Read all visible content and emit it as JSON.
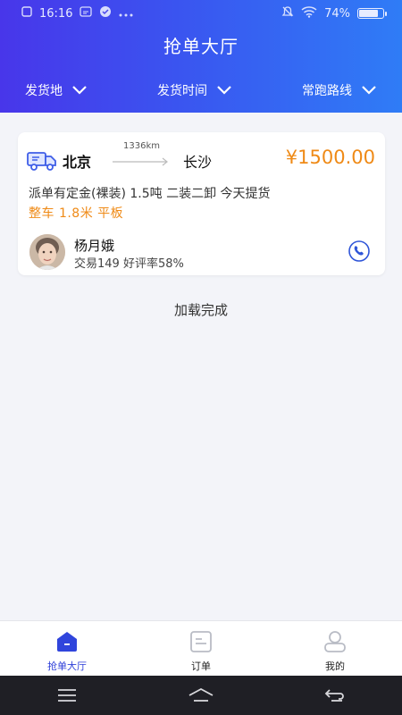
{
  "status_bar": {
    "time": "16:16",
    "battery": "74%"
  },
  "header": {
    "title": "抢单大厅",
    "filters": [
      {
        "label": "发货地"
      },
      {
        "label": "发货时间"
      },
      {
        "label": "常跑路线"
      }
    ]
  },
  "order_card": {
    "from": "北京",
    "to": "长沙",
    "distance": "1336km",
    "price": "¥1500.00",
    "description": "派单有定金(裸装) 1.5吨 二装二卸 今天提货",
    "truck_type": "整车 1.8米 平板",
    "user": {
      "name": "杨月娥",
      "stats": "交易149 好评率58%"
    }
  },
  "load_status": "加载完成",
  "tabbar": {
    "tabs": [
      {
        "label": "抢单大厅",
        "icon": "grab-order-icon",
        "active": true
      },
      {
        "label": "订单",
        "icon": "order-icon",
        "active": false
      },
      {
        "label": "我的",
        "icon": "profile-icon",
        "active": false
      }
    ]
  },
  "colors": {
    "header_start": "#4836ea",
    "header_end": "#2f7cf6",
    "price": "#ef8a16",
    "active_tab": "#2d3ed8"
  }
}
